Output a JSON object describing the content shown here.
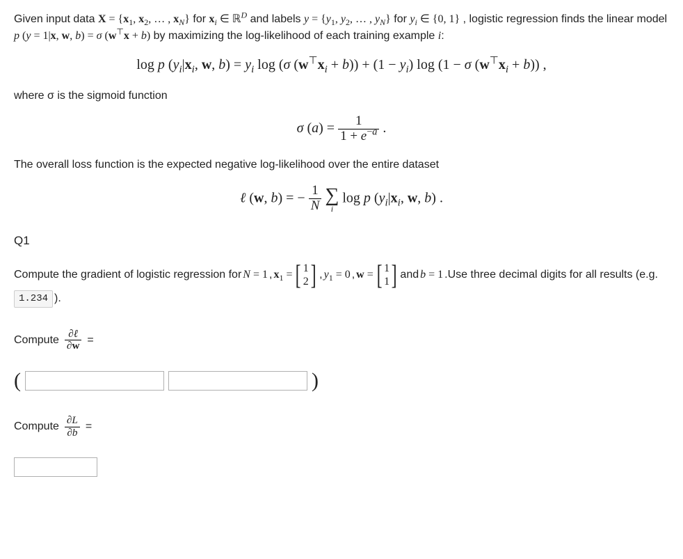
{
  "intro": {
    "p1_pre": "Given input data ",
    "p1_math1": "X = {x₁, x₂, …, x_N}",
    "p1_mid1": " for ",
    "p1_math2": "xᵢ ∈ ℝ^D",
    "p1_mid2": " and labels ",
    "p1_math3": "y = {y₁, y₂, …, y_N}",
    "p1_mid3": " for ",
    "p1_math4": "yᵢ ∈ {0, 1}",
    "p1_end": ", logistic regression finds the linear model ",
    "p1_math5": "p (y = 1|x, w, b) = σ (wᵀx + b)",
    "p1_tail": " by maximizing the log-likelihood of each training example ",
    "p1_i": "i",
    "p1_colon": ":"
  },
  "eq1": "log p (yᵢ|xᵢ, w, b) = yᵢ log (σ (wᵀxᵢ + b)) + (1 − yᵢ) log (1 − σ (wᵀxᵢ + b)) ,",
  "sigmoid_intro": "where σ is the sigmoid function",
  "eq2": {
    "lhs": "σ (a) = ",
    "num": "1",
    "den": "1 + e^{−a}",
    "tail": " ."
  },
  "loss_intro": "The overall loss function is the expected negative log-likelihood over the entire dataset",
  "eq3": {
    "lhs": "ℓ (w, b) = −",
    "frac_num": "1",
    "frac_den": "N",
    "sum": "∑",
    "sum_idx": "i",
    "rhs": " log p (yᵢ|xᵢ, w, b) ."
  },
  "q1": {
    "heading": "Q1",
    "line1_pre": "Compute the gradient of logistic regression for ",
    "N": "N = 1",
    "comma1": ", ",
    "x1_label": "x₁ = ",
    "x1_top": "1",
    "x1_bot": "2",
    "comma2": ", ",
    "y1": "y₁ = 0",
    "comma3": ", ",
    "w_label": "w = ",
    "w_top": "1",
    "w_bot": "1",
    "and": " and ",
    "b": "b = 1",
    "tail": ".Use three decimal digits for all results (e.g. ",
    "example": "1.234",
    "tail2": " )."
  },
  "compute1": {
    "label": "Compute ",
    "num": "∂ℓ",
    "den": "∂w",
    "eq": " ="
  },
  "compute2": {
    "label": "Compute ",
    "num": "∂L",
    "den": "∂b",
    "eq": " ="
  }
}
